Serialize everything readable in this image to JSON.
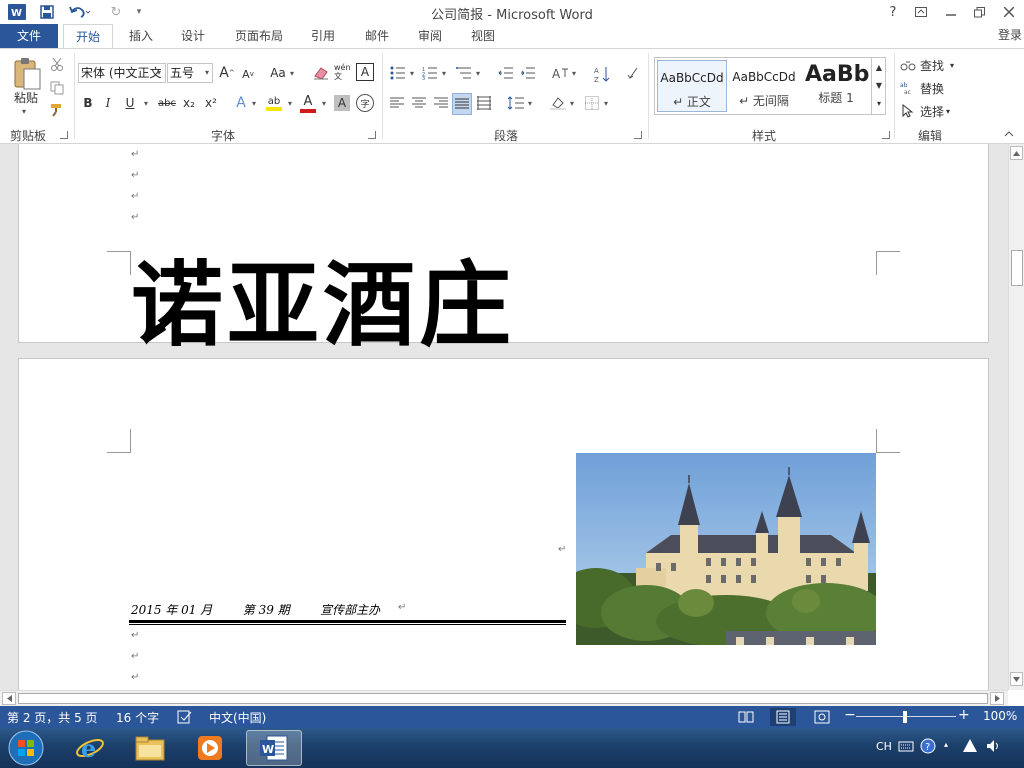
{
  "app": {
    "window_title": "公司简报 - Microsoft Word",
    "signin": "登录"
  },
  "ribbon_tabs": [
    {
      "label": "文件"
    },
    {
      "label": "开始"
    },
    {
      "label": "插入"
    },
    {
      "label": "设计"
    },
    {
      "label": "页面布局"
    },
    {
      "label": "引用"
    },
    {
      "label": "邮件"
    },
    {
      "label": "审阅"
    },
    {
      "label": "视图"
    }
  ],
  "active_tab": "开始",
  "clipboard": {
    "paste_label": "粘贴",
    "group_label": "剪贴板"
  },
  "font": {
    "family": "宋体 (中文正文",
    "size": "五号",
    "case_label": "Aa",
    "bold": "B",
    "italic": "I",
    "underline": "U",
    "strike": "abc",
    "subscript": "x₂",
    "superscript": "x²",
    "grow_font": "A",
    "shrink_font": "A",
    "pinyin": "wén 文",
    "char_border": "A",
    "text_effect": "A",
    "font_color": "A",
    "char_shade": "A",
    "enclose": "字",
    "highlight": "ab",
    "group_label": "字体"
  },
  "paragraph": {
    "group_label": "段落"
  },
  "styles": {
    "group_label": "样式",
    "items": [
      {
        "sample": "AaBbCcDd",
        "name": "↵ 正文"
      },
      {
        "sample": "AaBbCcDd",
        "name": "↵ 无间隔"
      },
      {
        "sample": "AaBb",
        "name": "标题 1"
      }
    ]
  },
  "editing": {
    "find": "查找",
    "replace": "替换",
    "select": "选择",
    "group_label": "编辑"
  },
  "document": {
    "title_text": "诺亚酒庄",
    "meta": "2015 年 01 月        第 39 期        宣传部主办",
    "para_mark": "↵"
  },
  "status": {
    "page": "第 2 页，共 5 页",
    "words": "16 个字",
    "language": "中文(中国)",
    "zoom": "100%"
  },
  "tray": {
    "ime": "CH"
  },
  "colors": {
    "word_blue": "#2b579a",
    "status_blue": "#2b579a",
    "taskbar": "#1c3f6a"
  }
}
